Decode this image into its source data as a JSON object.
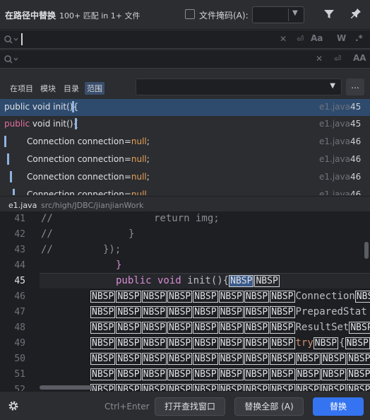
{
  "header": {
    "title": "在路径中替换",
    "match_count": "100+ 匹配 in 1+ 文件",
    "file_mask_label": "文件掩码(A):"
  },
  "search": {
    "find_value": "",
    "replace_value": ""
  },
  "scope": {
    "tabs": [
      {
        "label": "在项目"
      },
      {
        "label": "模块"
      },
      {
        "label": "目录"
      },
      {
        "label": "范围"
      }
    ],
    "active_tab": "范围",
    "select_value": "",
    "more_label": "..."
  },
  "results": [
    {
      "prefix": "",
      "keyword": "",
      "text": "public void init(){",
      "null": "",
      "suffix": "",
      "file": "e1.java",
      "line": "45"
    },
    {
      "prefix": "",
      "keyword": "public",
      "text": " void init(){",
      "null": "",
      "suffix": "",
      "file": "e1.java",
      "line": "45"
    },
    {
      "prefix": "",
      "keyword": "",
      "text": "Connection connection=",
      "null": "null",
      "suffix": ";",
      "file": "e1.java",
      "line": "46"
    },
    {
      "prefix": "",
      "keyword": "",
      "text": "Connection connection=",
      "null": "null",
      "suffix": ";",
      "file": "e1.java",
      "line": "46"
    },
    {
      "prefix": "",
      "keyword": "",
      "text": "Connection connection=",
      "null": "null",
      "suffix": ";",
      "file": "e1.java",
      "line": "46"
    },
    {
      "prefix": "",
      "keyword": "",
      "text": "Connection connection=",
      "null": "null",
      "suffix": "",
      "file": "e1.java",
      "line": "46"
    }
  ],
  "path": {
    "file": "e1.java",
    "directory": "src/high/JDBC/jianjianWork"
  },
  "editor": {
    "line_numbers": [
      "41",
      "42",
      "43",
      "44",
      "45",
      "46",
      "47",
      "48",
      "49",
      "50",
      "51",
      "52"
    ],
    "current_line": "45",
    "comment": "//",
    "line41_code": "return img;",
    "line42_code": "}",
    "line43_code": "});",
    "line44_code": "}",
    "line45_kw": "public void",
    "line45_code": " init(){",
    "nbsp": "NBSP",
    "connection_text": "Connection",
    "prepared_text": "PreparedStat",
    "resultset_text": "ResultSet",
    "try_kw": "try",
    "brace": "{"
  },
  "footer": {
    "hint": "Ctrl+Enter",
    "open_button": "打开查找窗口",
    "replace_all_button": "替换全部 (A)",
    "replace_button": "替换"
  },
  "colors": {
    "accent": "#3574f0",
    "selection": "#2e4b6e",
    "keyword_pink": "#e56da2",
    "null_orange": "#e8a15a"
  },
  "icons": [
    "filter-icon",
    "pin-icon",
    "search-icon",
    "clear-icon",
    "newline-icon",
    "match-case-icon",
    "whole-word-icon",
    "regex-icon",
    "preserve-case-icon",
    "chevron-down-icon",
    "gear-icon"
  ]
}
